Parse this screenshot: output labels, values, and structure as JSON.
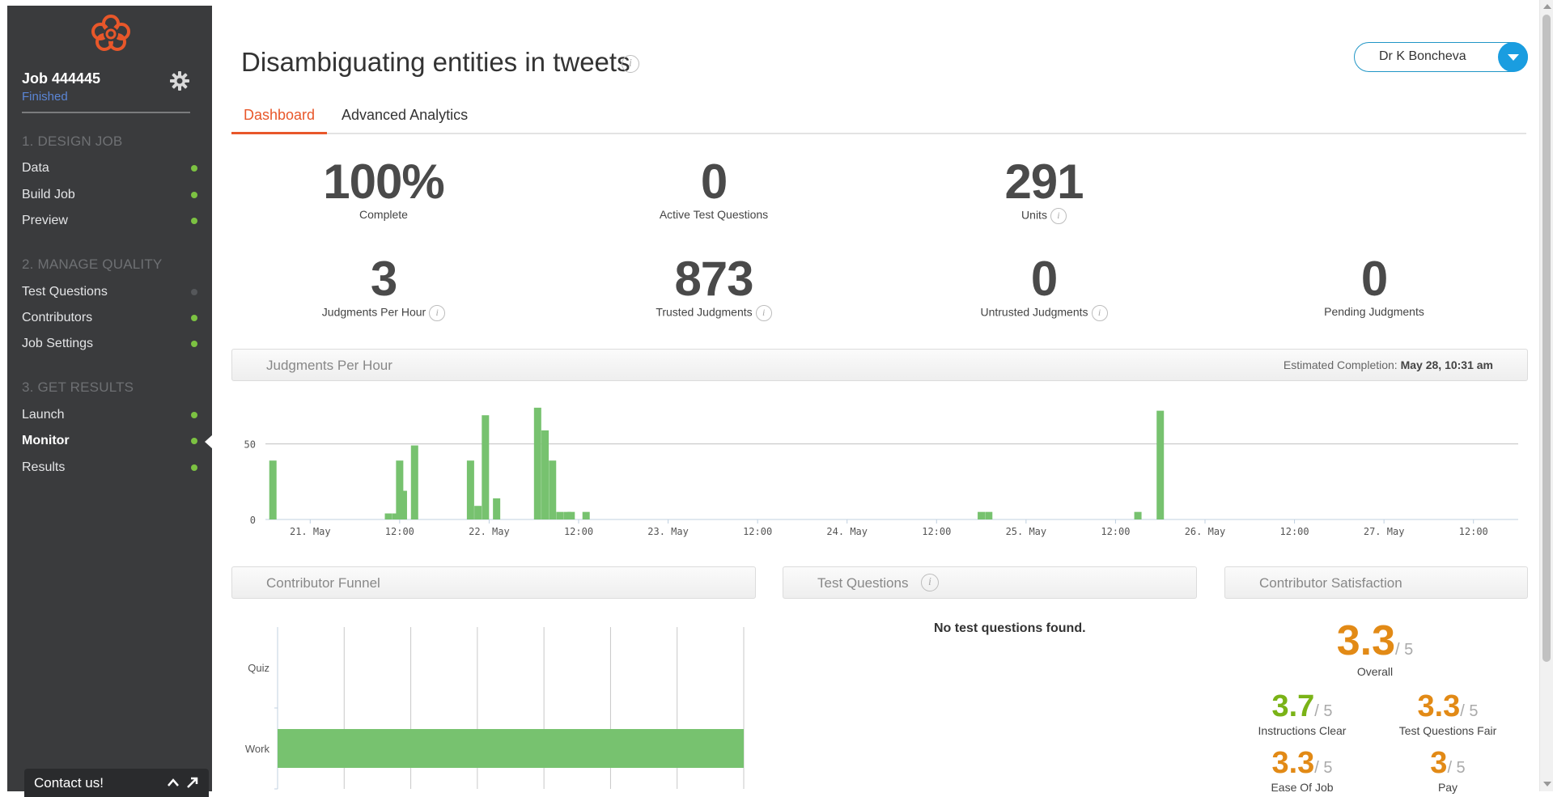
{
  "sidebar": {
    "job_title": "Job 444445",
    "job_status": "Finished",
    "sections": [
      {
        "title": "1. DESIGN JOB"
      },
      {
        "title": "2. MANAGE QUALITY"
      },
      {
        "title": "3. GET RESULTS"
      }
    ],
    "items": [
      {
        "label": "Data",
        "status": "green"
      },
      {
        "label": "Build Job",
        "status": "green"
      },
      {
        "label": "Preview",
        "status": "green"
      },
      {
        "label": "Test Questions",
        "status": "grey"
      },
      {
        "label": "Contributors",
        "status": "green"
      },
      {
        "label": "Job Settings",
        "status": "green"
      },
      {
        "label": "Launch",
        "status": "green"
      },
      {
        "label": "Monitor",
        "status": "green"
      },
      {
        "label": "Results",
        "status": "green"
      }
    ],
    "contact_label": "Contact us!"
  },
  "header": {
    "title": "Disambiguating entities in tweets",
    "info_glyph": "i",
    "user_name": "Dr K Boncheva"
  },
  "tabs": [
    {
      "label": "Dashboard",
      "active": true
    },
    {
      "label": "Advanced Analytics",
      "active": false
    }
  ],
  "stats": [
    {
      "value": "100%",
      "label": "Complete"
    },
    {
      "value": "0",
      "label": "Active Test Questions"
    },
    {
      "value": "291",
      "label": "Units"
    },
    {
      "value": "3",
      "label": "Judgments Per Hour"
    },
    {
      "value": "873",
      "label": "Trusted Judgments"
    },
    {
      "value": "0",
      "label": "Untrusted Judgments"
    },
    {
      "value": "0",
      "label": "Pending Judgments"
    }
  ],
  "judgments_panel": {
    "title": "Judgments Per Hour",
    "estimate_label": "Estimated Completion:",
    "estimate_value": "May 28, 10:31 am"
  },
  "chart_data": [
    {
      "type": "bar",
      "title": "Judgments Per Hour",
      "ylim": [
        0,
        75
      ],
      "yticks": [
        0,
        50
      ],
      "xlim": [
        0,
        168
      ],
      "xticks": [
        {
          "pos": 6,
          "label": "21. May"
        },
        {
          "pos": 18,
          "label": "12:00"
        },
        {
          "pos": 30,
          "label": "22. May"
        },
        {
          "pos": 42,
          "label": "12:00"
        },
        {
          "pos": 54,
          "label": "23. May"
        },
        {
          "pos": 66,
          "label": "12:00"
        },
        {
          "pos": 78,
          "label": "24. May"
        },
        {
          "pos": 90,
          "label": "12:00"
        },
        {
          "pos": 102,
          "label": "25. May"
        },
        {
          "pos": 114,
          "label": "12:00"
        },
        {
          "pos": 126,
          "label": "26. May"
        },
        {
          "pos": 138,
          "label": "12:00"
        },
        {
          "pos": 150,
          "label": "27. May"
        },
        {
          "pos": 162,
          "label": "12:00"
        }
      ],
      "x": [
        1,
        16.5,
        17.5,
        18,
        18.5,
        20,
        27.5,
        28.5,
        29.5,
        31,
        36.5,
        37.5,
        38.5,
        39.5,
        40.5,
        41,
        43,
        96,
        97,
        117,
        120
      ],
      "values": [
        39,
        4,
        4,
        39,
        19,
        49,
        39,
        9,
        69,
        14,
        74,
        59,
        39,
        5,
        5,
        5,
        5,
        5,
        5,
        5,
        72
      ]
    },
    {
      "type": "bar",
      "title": "Contributor Funnel",
      "orientation": "horizontal",
      "categories": [
        "Quiz",
        "Work"
      ],
      "values": [
        0,
        100
      ]
    }
  ],
  "funnel_panel": {
    "title": "Contributor Funnel"
  },
  "test_questions_panel": {
    "title": "Test Questions",
    "empty_text": "No test questions found."
  },
  "satisfaction_panel": {
    "title": "Contributor Satisfaction",
    "out_of": "/ 5",
    "overall": {
      "value": "3.3",
      "label": "Overall"
    },
    "items": [
      {
        "value": "3.7",
        "label": "Instructions Clear"
      },
      {
        "value": "3.3",
        "label": "Test Questions Fair"
      },
      {
        "value": "3.3",
        "label": "Ease Of Job"
      },
      {
        "value": "3",
        "label": "Pay"
      }
    ]
  },
  "colors": {
    "accent": "#e8572a",
    "sidebar_bg": "#3a3b3d",
    "status_green": "#7cc242",
    "bar_green": "#77c26f",
    "score_orange": "#e28a16",
    "score_green": "#7ab317",
    "user_blue": "#1a9de0"
  },
  "icons": [
    "logo-icon",
    "gear-icon",
    "info-icon",
    "chevron-up-icon",
    "expand-icon",
    "dropdown-caret-icon"
  ]
}
